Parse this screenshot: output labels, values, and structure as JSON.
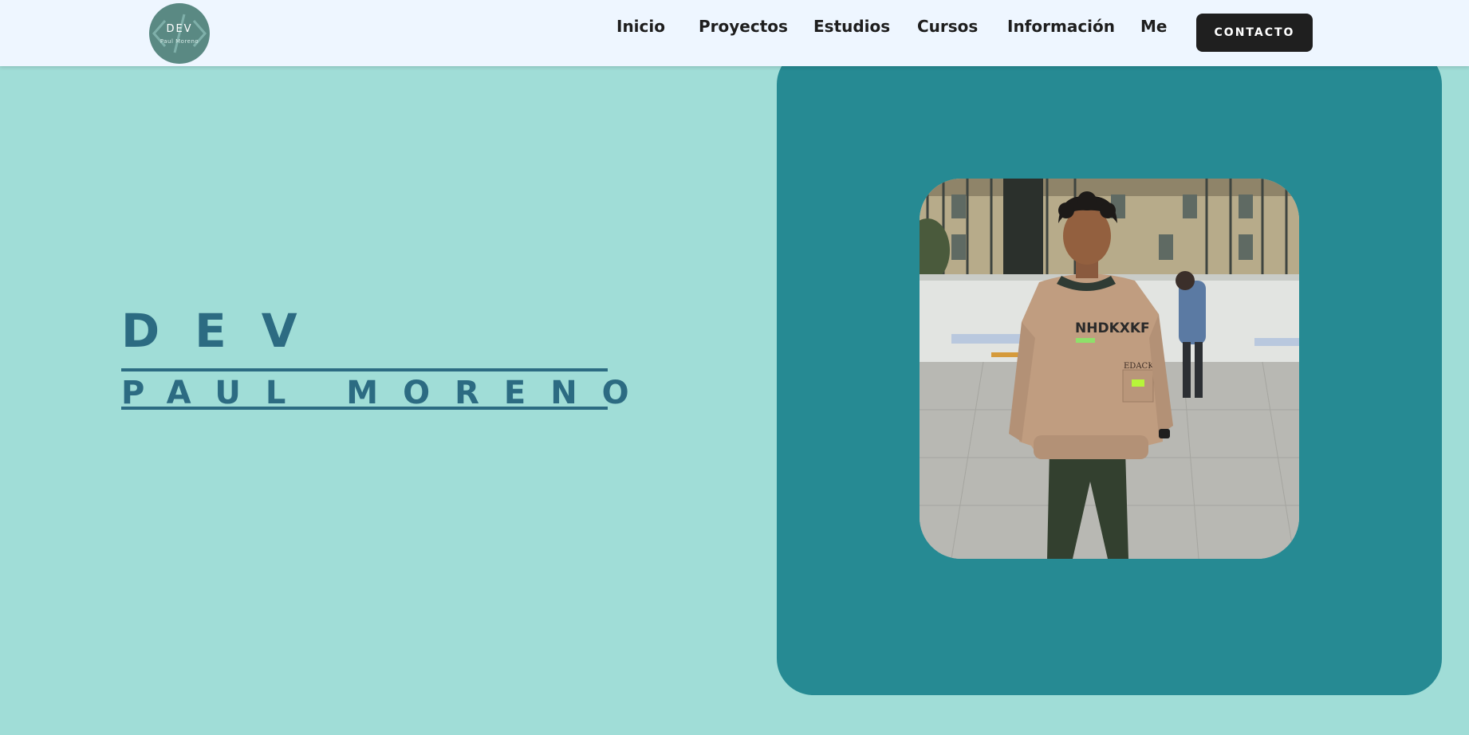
{
  "header": {
    "logo": {
      "title": "DEV",
      "subtitle": "Paul Moreno",
      "icon": "code-brackets-icon"
    },
    "nav": [
      {
        "label": "Inicio"
      },
      {
        "label": "Proyectos"
      },
      {
        "label": "Estudios"
      },
      {
        "label": "Cursos"
      },
      {
        "label": "Información"
      },
      {
        "label": "Me"
      }
    ],
    "contact_label": "CONTACTO"
  },
  "hero": {
    "title": "DEV",
    "name": "PAUL MORENO"
  },
  "photo_card": {
    "sweater_text": "NHDKXKF",
    "pocket_text": "EDACKE"
  },
  "colors": {
    "page_bg": "#a0ddd7",
    "navbar_bg": "#eef6ff",
    "accent": "#268a93",
    "text_primary": "#2c6b82",
    "button_bg": "#1f1f1f"
  }
}
